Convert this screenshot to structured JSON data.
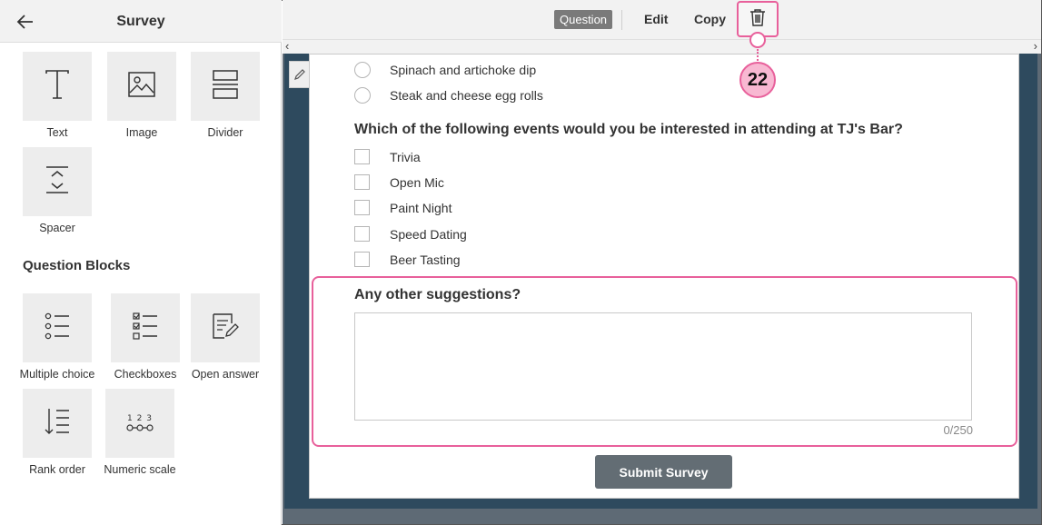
{
  "sidebar": {
    "title": "Survey",
    "content_blocks": [
      {
        "label": "Text",
        "icon": "text-icon"
      },
      {
        "label": "Image",
        "icon": "image-icon"
      },
      {
        "label": "Divider",
        "icon": "divider-icon"
      },
      {
        "label": "Spacer",
        "icon": "spacer-icon"
      }
    ],
    "question_blocks_title": "Question Blocks",
    "question_blocks": [
      {
        "label": "Multiple choice",
        "icon": "multiple-choice-icon"
      },
      {
        "label": "Checkboxes",
        "icon": "checkboxes-icon"
      },
      {
        "label": "Open answer",
        "icon": "open-answer-icon"
      },
      {
        "label": "Rank order",
        "icon": "rank-order-icon"
      },
      {
        "label": "Numeric scale",
        "icon": "numeric-scale-icon"
      }
    ]
  },
  "toolbar": {
    "question_label": "Question",
    "edit_label": "Edit",
    "copy_label": "Copy"
  },
  "survey": {
    "previous_options": [
      "Spinach and artichoke dip",
      "Steak and cheese egg rolls"
    ],
    "events_question": "Which of the following events would you be interested in attending at TJ's Bar?",
    "events_options": [
      "Trivia",
      "Open Mic",
      "Paint Night",
      "Speed Dating",
      "Beer Tasting"
    ],
    "suggestions_question": "Any other suggestions?",
    "char_counter": "0/250",
    "submit_label": "Submit Survey",
    "numeric_scale_digits": "1 2 3"
  },
  "callout": {
    "number": "22"
  },
  "colors": {
    "accent_pink": "#e8609b",
    "badge_fill": "#f8b8d2",
    "canvas_bg": "#2e4a5e",
    "submit_bg": "#636d74"
  }
}
